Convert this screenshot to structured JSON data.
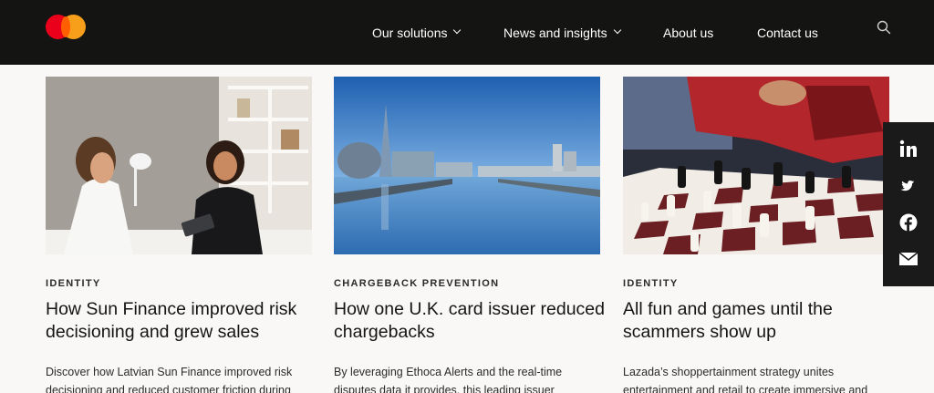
{
  "nav": {
    "items": [
      {
        "label": "Our solutions"
      },
      {
        "label": "News and insights"
      },
      {
        "label": "About us"
      },
      {
        "label": "Contact us"
      }
    ]
  },
  "cards": [
    {
      "eyebrow": "IDENTITY",
      "title": "How Sun Finance improved risk decisioning and grew sales",
      "description": "Discover how Latvian Sun Finance improved risk decisioning and reduced customer friction during"
    },
    {
      "eyebrow": "CHARGEBACK PREVENTION",
      "title": "How one U.K. card issuer reduced chargebacks",
      "description": "By leveraging Ethoca Alerts and the real-time disputes data it provides, this leading issuer"
    },
    {
      "eyebrow": "IDENTITY",
      "title": "All fun and games until the scammers show up",
      "description": "Lazada’s shoppertainment strategy unites entertainment and retail to create immersive and"
    }
  ],
  "share": {
    "icons": [
      "linkedin-icon",
      "twitter-icon",
      "facebook-icon",
      "email-icon"
    ]
  },
  "colors": {
    "header_bg": "#141413",
    "page_bg": "#f9f8f6",
    "logo_red": "#eb001b",
    "logo_orange": "#f79e1b"
  }
}
